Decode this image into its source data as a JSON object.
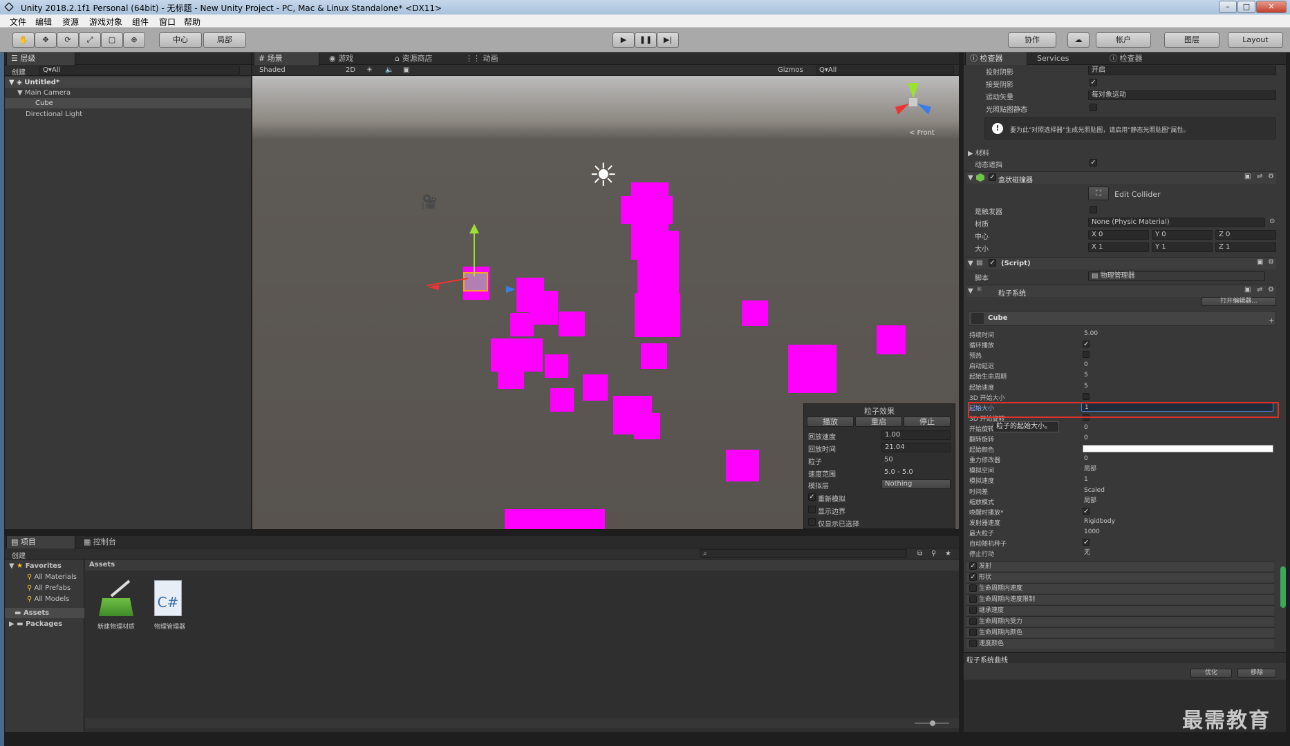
{
  "window": {
    "title": "Unity 2018.2.1f1 Personal (64bit) - 无标题 - New Unity Project - PC, Mac & Linux Standalone* <DX11>",
    "min": "–",
    "max": "□",
    "close": "✕"
  },
  "menu": [
    "文件",
    "编辑",
    "资源",
    "游戏对象",
    "组件",
    "窗口",
    "帮助"
  ],
  "toolbar": {
    "pivot": "中心",
    "local": "局部",
    "collab": "协作",
    "account": "帐户",
    "layers": "图层",
    "layout": "Layout"
  },
  "hierarchy": {
    "tab": "层级",
    "create": "创建",
    "search": "Q▾All",
    "scene": "Untitled*",
    "items": [
      "Main Camera",
      "Cube",
      "Directional Light"
    ]
  },
  "scene": {
    "tabs": [
      "场景",
      "游戏",
      "资源商店",
      "动画器"
    ],
    "shading": "Shaded",
    "mode2d": "2D",
    "gizmos": "Gizmos",
    "search": "Q▾All",
    "orient": "< Front"
  },
  "particle_panel": {
    "title": "粒子效果",
    "play": "播放",
    "restart": "重启",
    "stop": "停止",
    "rows": [
      {
        "label": "回放速度",
        "value": "1.00"
      },
      {
        "label": "回放时间",
        "value": "21.04"
      },
      {
        "label": "粒子",
        "value": "50"
      },
      {
        "label": "速度范围",
        "value": "5.0 - 5.0"
      },
      {
        "label": "模拟层",
        "value": "Nothing"
      }
    ],
    "checks": [
      {
        "label": "重新模拟",
        "checked": true
      },
      {
        "label": "显示边界",
        "checked": false
      },
      {
        "label": "仅显示已选择",
        "checked": false
      }
    ]
  },
  "project": {
    "tabs": [
      "项目",
      "控制台"
    ],
    "create": "创建",
    "favorites": "Favorites",
    "fav_items": [
      "All Materials",
      "All Prefabs",
      "All Models"
    ],
    "folders": [
      "Assets",
      "Packages"
    ],
    "breadcrumb": "Assets",
    "assets": [
      "新建物理材质",
      "物理管理器"
    ]
  },
  "inspector": {
    "tabs": [
      "检查器",
      "Services",
      "检查器"
    ],
    "top_rows": [
      {
        "label": "投射阴影",
        "value": "开启"
      },
      {
        "label": "接受阴影",
        "value": "✓"
      },
      {
        "label": "运动矢量",
        "value": "每对象运动"
      },
      {
        "label": "光照贴图静态",
        "value": ""
      }
    ],
    "info": "要为此\"对照选择器\"生成光照贴图，请启用\"静态光照贴图\"属性。",
    "material": "材料",
    "dynamic_occlusion": "动态遮挡",
    "box_collider": {
      "title": "盒状碰撞器",
      "edit": "Edit Collider",
      "is_trigger": "是触发器",
      "material_label": "材质",
      "material_value": "None (Physic Material)",
      "center": "中心",
      "size": "大小",
      "cx": "X 0",
      "cy": "Y 0",
      "cz": "Z 0",
      "sx": "X 1",
      "sy": "Y 1",
      "sz": "Z 1"
    },
    "script": {
      "title": "(Script)",
      "label": "脚本",
      "value": "物理管理器"
    },
    "particle_system": {
      "title": "粒子系统",
      "open_editor": "打开编辑器...",
      "name": "Cube",
      "rows": [
        {
          "label": "持续时间",
          "value": "5.00"
        },
        {
          "label": "循环播放",
          "value": "✓"
        },
        {
          "label": "预热",
          "value": ""
        },
        {
          "label": "启动延迟",
          "value": "0"
        },
        {
          "label": "起始生命周期",
          "value": "5"
        },
        {
          "label": "起始速度",
          "value": "5"
        },
        {
          "label": "3D 开始大小",
          "value": ""
        },
        {
          "label": "起始大小",
          "value": "1"
        },
        {
          "label": "3D 开始旋转",
          "value": ""
        },
        {
          "label": "开始旋转",
          "value": "0"
        },
        {
          "label": "翻转旋转",
          "value": "0"
        },
        {
          "label": "起始颜色",
          "value": ""
        },
        {
          "label": "重力修改器",
          "value": "0"
        },
        {
          "label": "模拟空间",
          "value": "局部"
        },
        {
          "label": "模拟速度",
          "value": "1"
        },
        {
          "label": "时间差",
          "value": "Scaled"
        },
        {
          "label": "缩放模式",
          "value": "局部"
        },
        {
          "label": "唤醒时播放*",
          "value": "✓"
        },
        {
          "label": "发射器速度",
          "value": "Rigidbody"
        },
        {
          "label": "最大粒子",
          "value": "1000"
        },
        {
          "label": "自动随机种子",
          "value": "✓"
        },
        {
          "label": "停止行动",
          "value": "无"
        }
      ],
      "tooltip": "粒子的起始大小。",
      "modules": [
        {
          "label": "发射",
          "checked": true
        },
        {
          "label": "形状",
          "checked": true
        },
        {
          "label": "生命周期内速度",
          "checked": false
        },
        {
          "label": "生命周期内速度限制",
          "checked": false
        },
        {
          "label": "继承速度",
          "checked": false
        },
        {
          "label": "生命周期内受力",
          "checked": false
        },
        {
          "label": "生命周期内颜色",
          "checked": false
        },
        {
          "label": "速度颜色",
          "checked": false
        }
      ]
    },
    "curves": "粒子系统曲线",
    "optimize": "优化",
    "remove": "移除"
  },
  "watermark": "最需教育"
}
